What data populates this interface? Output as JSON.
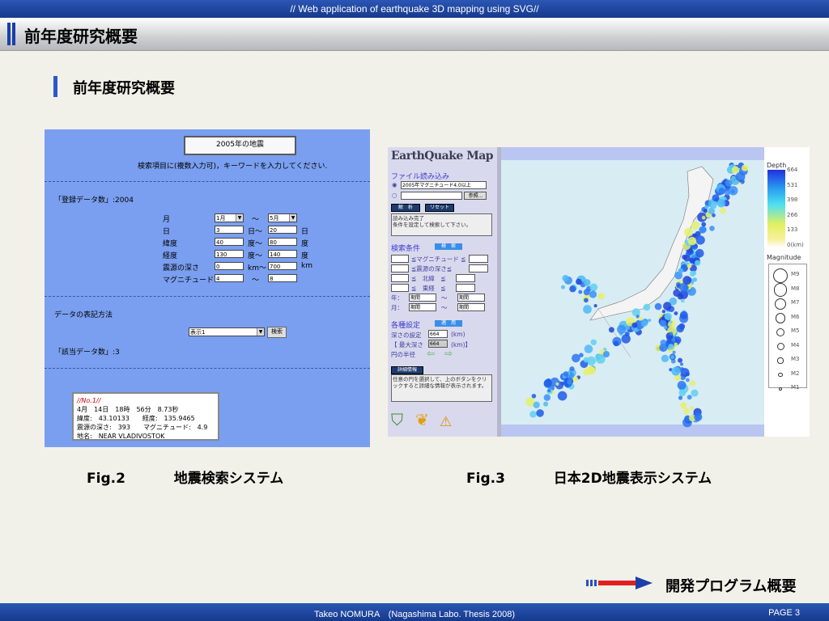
{
  "header": {
    "banner": "// Web application of earthquake 3D mapping using SVG//",
    "title": "前年度研究概要"
  },
  "section_title": "前年度研究概要",
  "fig2": {
    "box_title": "2005年の地震",
    "instruction": "検索項目に(複数入力可)，キーワードを入力してください.",
    "registered": "「登録データ数」:2004",
    "labels": {
      "month": "月",
      "day": "日",
      "lat": "緯度",
      "lon": "経度",
      "depth": "震源の深さ",
      "mag": "マグニチュード"
    },
    "tilde": "〜",
    "month_from": "1月",
    "month_to": "5月",
    "day_from": "3",
    "day_sep": "日〜",
    "day_to": "20",
    "day_unit": "日",
    "lat_from": "40",
    "lat_sep": "度〜",
    "lat_to": "80",
    "lat_unit": "度",
    "lon_from": "130",
    "lon_sep": "度〜",
    "lon_to": "140",
    "lon_unit": "度",
    "depth_from": "0",
    "depth_sep": "km〜",
    "depth_to": "700",
    "depth_unit": "km",
    "mag_from": "4",
    "mag_to": "8",
    "display_method_label": "データの表記方法",
    "display_option": "表示1",
    "search_button": "検索",
    "matched": "「該当データ数」:3",
    "info": {
      "no": "//No.1//",
      "time": "4月　14日　18時　56分　8.73秒",
      "coords": "緯度:　43.10133　　経度:　135.9465",
      "depth_mag": "震源の深さ:　393　　マグニチュード:　4.9",
      "place": "地名:　NEAR VLADIVOSTOK"
    }
  },
  "fig3": {
    "logo": "EarthQuake Map",
    "file_load": "ファイル読み込み",
    "file_option": "2005年マグニチュード4.0以上",
    "browse": "参照...",
    "analyze": "解　析",
    "reset": "リセット",
    "status1": "読み込み完了",
    "status2": "条件を設定して検索して下さい。",
    "search_cond": "検索条件",
    "search_btn": "検　索",
    "cond_mag": "≦マグニチュード ≦",
    "cond_depth": "≦震源の深さ≦",
    "cond_lat": "≦　北緯　≦",
    "cond_lon": "≦　東経　≦",
    "year": "年：",
    "month": "月：",
    "period": "期間",
    "settings": "各種設定",
    "apply": "適　用",
    "depth_setting": "深さの設定",
    "depth_value": "664",
    "km": "(km)",
    "max_depth": "【 最大深さ",
    "max_depth_value": "664",
    "max_km": "(km)】",
    "radius": "円の半径",
    "detail": "詳細情報",
    "detail_text": "任意の円を選択して、上のボタンをクリックすると詳細な情報が表示されます。",
    "legend": {
      "depth_title": "Depth",
      "depth_ticks": [
        "664",
        "531",
        "398",
        "266",
        "133",
        "0(km)"
      ],
      "mag_title": "Magnitude",
      "mags": [
        "M9",
        "M8",
        "M7",
        "M6",
        "M5",
        "M4",
        "M3",
        "M2",
        "M1"
      ]
    }
  },
  "captions": {
    "fig2_label": "Fig.2",
    "fig2_text": "地震検索システム",
    "fig3_label": "Fig.3",
    "fig3_text": "日本2D地震表示システム"
  },
  "next_link": "開発プログラム概要",
  "footer": {
    "credit": "Takeo NOMURA　(Nagashima Labo. Thesis 2008)",
    "page": "PAGE 3"
  }
}
